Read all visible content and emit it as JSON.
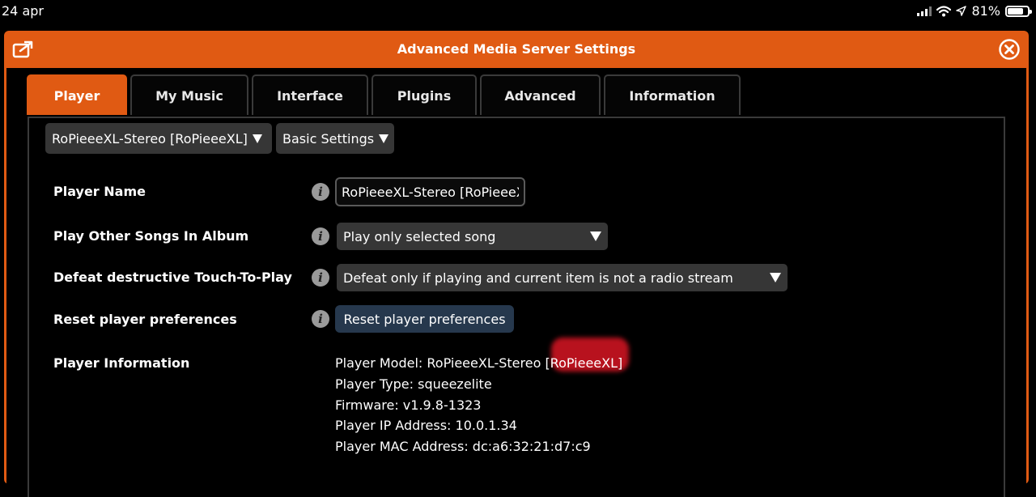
{
  "status_bar": {
    "date": "24 apr",
    "battery": "81%",
    "battery_level": 0.81
  },
  "dialog": {
    "title": "Advanced Media Server Settings",
    "header_icons": [
      "export-icon",
      "close-circle-icon"
    ],
    "accent_color": "#e05a13"
  },
  "tabs": [
    {
      "label": "Player",
      "active": true
    },
    {
      "label": "My Music",
      "active": false
    },
    {
      "label": "Interface",
      "active": false
    },
    {
      "label": "Plugins",
      "active": false
    },
    {
      "label": "Advanced",
      "active": false
    },
    {
      "label": "Information",
      "active": false
    }
  ],
  "player_selector": {
    "value": "RoPieeeXL-Stereo [RoPieeeXL]"
  },
  "settings_selector": {
    "value": "Basic Settings"
  },
  "settings": {
    "player_name": {
      "label": "Player Name",
      "value": "RoPieeeXL-Stereo [RoPieeeXL]"
    },
    "play_other_songs": {
      "label": "Play Other Songs In Album",
      "value": "Play only selected song"
    },
    "defeat_touch": {
      "label": "Defeat destructive Touch-To-Play",
      "value": "Defeat only if playing and current item is not a radio stream"
    },
    "reset_prefs": {
      "label": "Reset player preferences",
      "button": "Reset player preferences"
    },
    "player_info": {
      "label": "Player Information",
      "lines": [
        "Player Model: RoPieeeXL-Stereo [RoPieeeXL]",
        "Player Type: squeezelite",
        "Firmware: v1.9.8-1323",
        "Player IP Address: 10.0.1.34",
        "Player MAC Address: dc:a6:32:21:d7:c9"
      ]
    }
  }
}
